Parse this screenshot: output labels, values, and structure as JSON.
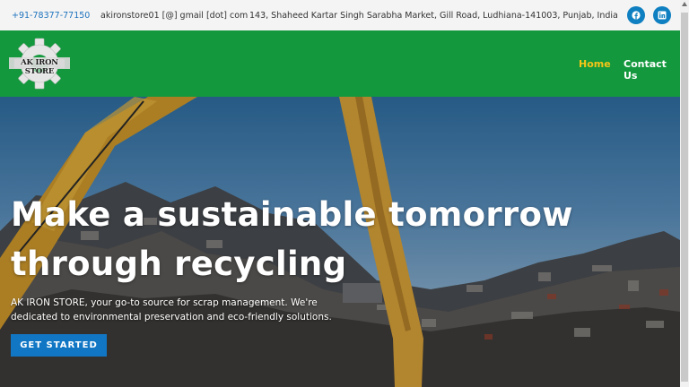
{
  "topbar": {
    "phone": "+91-78377-77150",
    "email": "akironstore01 [@] gmail [dot] com",
    "address": "143, Shaheed Kartar Singh Sarabha Market, Gill Road, Ludhiana-141003, Punjab, India",
    "social": [
      {
        "icon": "facebook-icon"
      },
      {
        "icon": "linkedin-icon"
      }
    ]
  },
  "header": {
    "logo_text": "AK IRON STORE",
    "nav": [
      {
        "label": "Home",
        "active": true
      },
      {
        "label": "Contact Us",
        "active": false
      }
    ]
  },
  "hero": {
    "title": "Make a sustainable tomorrow through recycling",
    "description": "AK IRON STORE, your go-to source for scrap management. We're dedicated to environmental preservation and eco-friendly solutions.",
    "cta_label": "GET STARTED"
  },
  "colors": {
    "header_bg": "#13983d",
    "nav_active": "#f5c518",
    "accent_blue": "#1177c5",
    "topbar_bg": "#f4f4f4"
  }
}
